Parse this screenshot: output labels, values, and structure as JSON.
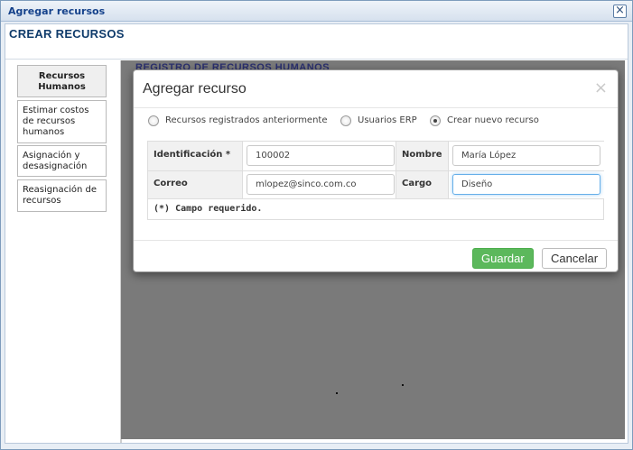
{
  "window": {
    "title": "Agregar recursos",
    "close_glyph": "×"
  },
  "page": {
    "title": "CREAR RECURSOS"
  },
  "sidebar": {
    "items": [
      {
        "label": "Recursos Humanos",
        "active": true
      },
      {
        "label": "Estimar costos de recursos humanos",
        "active": false
      },
      {
        "label": "Asignación y desasignación",
        "active": false
      },
      {
        "label": "Reasignación de recursos",
        "active": false
      }
    ]
  },
  "background_heading": "REGISTRO DE RECURSOS HUMANOS",
  "modal": {
    "title": "Agregar recurso",
    "close_glyph": "×",
    "radio_options": [
      {
        "label": "Recursos registrados anteriormente",
        "checked": false
      },
      {
        "label": "Usuarios ERP",
        "checked": false
      },
      {
        "label": "Crear nuevo recurso",
        "checked": true
      }
    ],
    "form": {
      "identificacion": {
        "label": "Identificación *",
        "value": "100002"
      },
      "nombre": {
        "label": "Nombre",
        "value": "María López"
      },
      "correo": {
        "label": "Correo",
        "value": "mlopez@sinco.com.co"
      },
      "cargo": {
        "label": "Cargo",
        "value": "Diseño"
      },
      "required_note": "(*) Campo requerido."
    },
    "buttons": {
      "save": "Guardar",
      "cancel": "Cancelar"
    }
  },
  "colors": {
    "accent_title": "#15428b",
    "save_button": "#5cb85c",
    "overlay": "#7a7a7a"
  }
}
